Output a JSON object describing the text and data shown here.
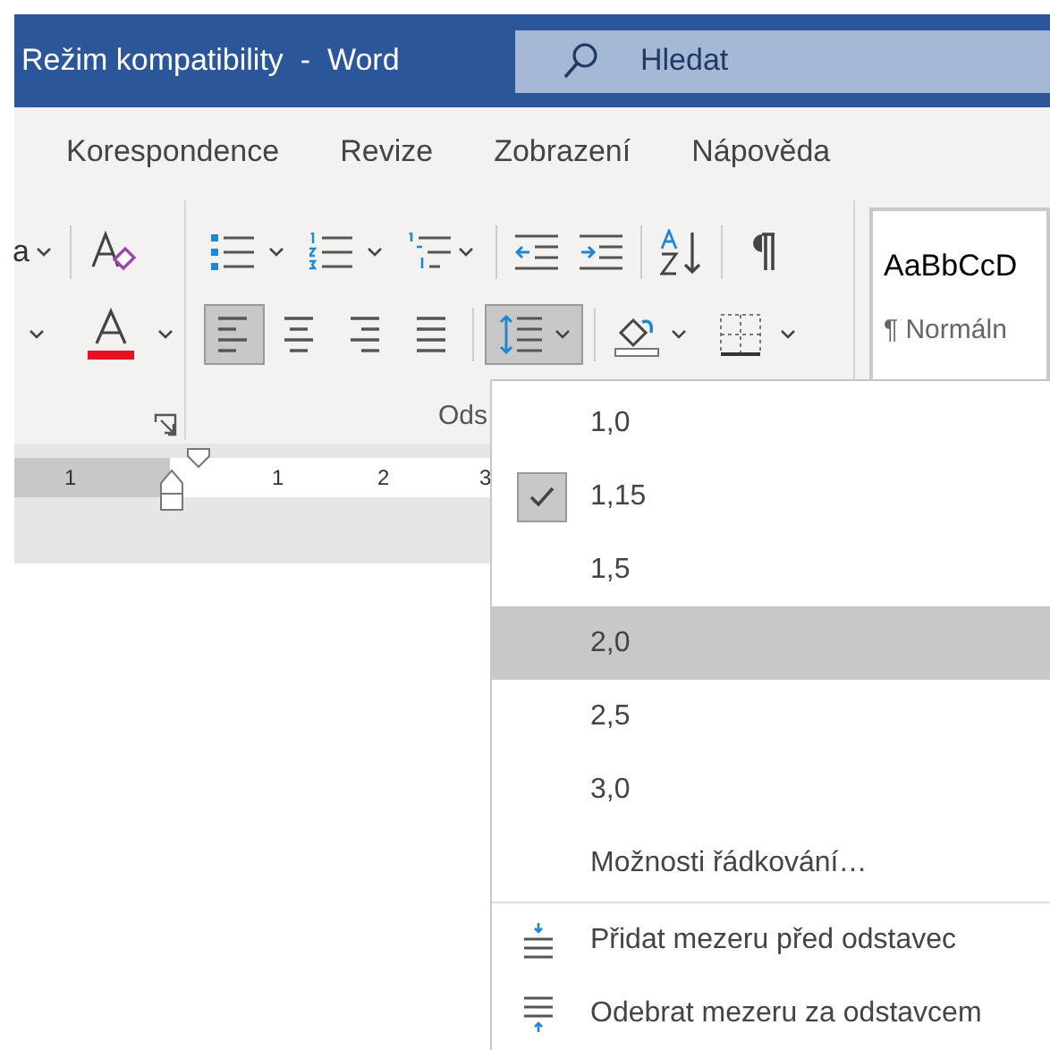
{
  "window": {
    "title": "Režim kompatibility  -  Word"
  },
  "search": {
    "placeholder": "Hledat"
  },
  "tabs": [
    {
      "label": "Korespondence"
    },
    {
      "label": "Revize"
    },
    {
      "label": "Zobrazení"
    },
    {
      "label": "Nápověda"
    }
  ],
  "ribbon": {
    "change_case": "a",
    "paragraph_group_label": "Ods",
    "alignment": [
      {
        "kind": "left",
        "selected": true
      },
      {
        "kind": "center",
        "selected": false
      },
      {
        "kind": "right",
        "selected": false
      },
      {
        "kind": "justify",
        "selected": false
      }
    ],
    "line_spacing_button": {
      "expanded": true
    },
    "styles": [
      {
        "preview": "AaBbCcD",
        "name": "¶ Normáln"
      }
    ]
  },
  "ruler": {
    "numbers": [
      "1",
      "1",
      "2",
      "3"
    ]
  },
  "line_spacing_menu": {
    "options": [
      {
        "label": "1,0",
        "checked": false,
        "selected": false
      },
      {
        "label": "1,15",
        "checked": true,
        "selected": false
      },
      {
        "label": "1,5",
        "checked": false,
        "selected": false
      },
      {
        "label": "2,0",
        "checked": false,
        "selected": true
      },
      {
        "label": "2,5",
        "checked": false,
        "selected": false
      },
      {
        "label": "3,0",
        "checked": false,
        "selected": false
      }
    ],
    "more": "Možnosti řádkování…",
    "actions": [
      {
        "kind": "add_before",
        "label": "Přidat mezeru před odstavec"
      },
      {
        "kind": "remove_after",
        "label": "Odebrat mezeru za odstavcem"
      }
    ]
  }
}
